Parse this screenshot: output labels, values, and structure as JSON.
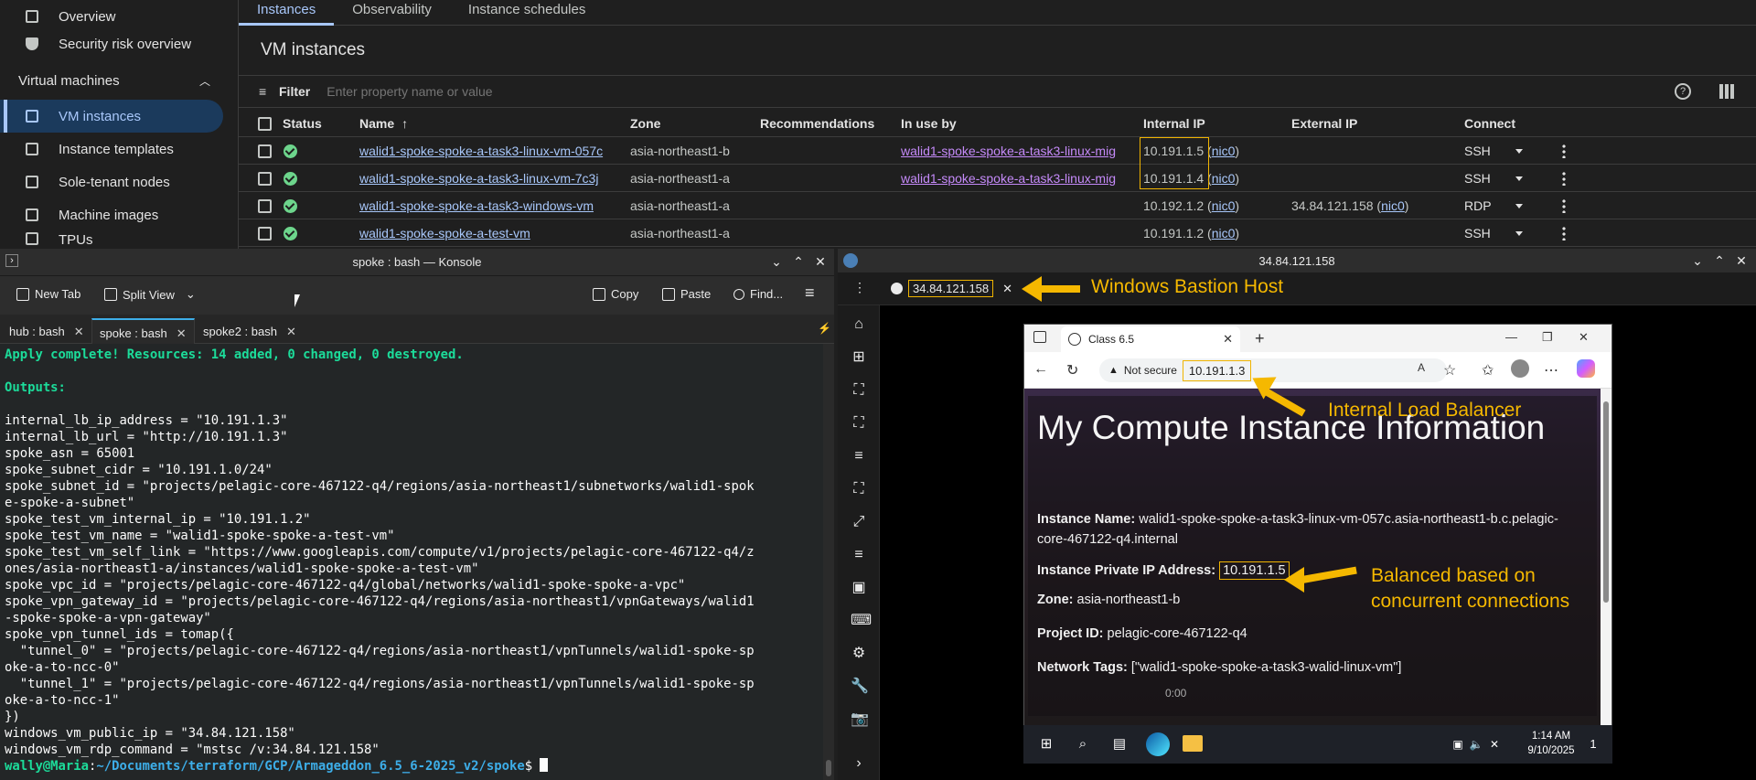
{
  "gcp": {
    "sidebar": {
      "items_top": [
        {
          "label": "Overview"
        },
        {
          "label": "Security risk overview"
        }
      ],
      "section": "Virtual machines",
      "items": [
        {
          "label": "VM instances"
        },
        {
          "label": "Instance templates"
        },
        {
          "label": "Sole-tenant nodes"
        },
        {
          "label": "Machine images"
        },
        {
          "label": "TPUs"
        }
      ]
    },
    "tabs": [
      "Instances",
      "Observability",
      "Instance schedules"
    ],
    "title": "VM instances",
    "filter": {
      "label": "Filter",
      "placeholder": "Enter property name or value"
    },
    "columns": {
      "status": "Status",
      "name": "Name",
      "zone": "Zone",
      "recommendations": "Recommendations",
      "in_use_by": "In use by",
      "internal_ip": "Internal IP",
      "external_ip": "External IP",
      "connect": "Connect"
    },
    "rows": [
      {
        "name": "walid1-spoke-spoke-a-task3-linux-vm-057c",
        "zone": "asia-northeast1-b",
        "in_use_by": "walid1-spoke-spoke-a-task3-linux-mig",
        "internal_ip": "10.191.1.5",
        "internal_nic": "nic0",
        "external_ip": "",
        "external_nic": "",
        "connect": "SSH"
      },
      {
        "name": "walid1-spoke-spoke-a-task3-linux-vm-7c3j",
        "zone": "asia-northeast1-a",
        "in_use_by": "walid1-spoke-spoke-a-task3-linux-mig",
        "internal_ip": "10.191.1.4",
        "internal_nic": "nic0",
        "external_ip": "",
        "external_nic": "",
        "connect": "SSH"
      },
      {
        "name": "walid1-spoke-spoke-a-task3-windows-vm",
        "zone": "asia-northeast1-a",
        "in_use_by": "",
        "internal_ip": "10.192.1.2",
        "internal_nic": "nic0",
        "external_ip": "34.84.121.158",
        "external_nic": "nic0",
        "connect": "RDP"
      },
      {
        "name": "walid1-spoke-spoke-a-test-vm",
        "zone": "asia-northeast1-a",
        "in_use_by": "",
        "internal_ip": "10.191.1.2",
        "internal_nic": "nic0",
        "external_ip": "",
        "external_nic": "",
        "connect": "SSH"
      }
    ]
  },
  "konsole": {
    "window_title": "spoke : bash — Konsole",
    "toolbar": {
      "new_tab": "New Tab",
      "split_view": "Split View",
      "copy": "Copy",
      "paste": "Paste",
      "find": "Find..."
    },
    "tabs": [
      "hub : bash",
      "spoke : bash",
      "spoke2 : bash"
    ],
    "active_tab": 1,
    "terminal_lines": [
      {
        "text": "Apply complete! Resources: 14 added, 0 changed, 0 destroyed.",
        "style": "green"
      },
      {
        "text": "",
        "style": ""
      },
      {
        "text": "Outputs:",
        "style": "green"
      },
      {
        "text": "",
        "style": ""
      },
      {
        "text": "internal_lb_ip_address = \"10.191.1.3\"",
        "style": ""
      },
      {
        "text": "internal_lb_url = \"http://10.191.1.3\"",
        "style": ""
      },
      {
        "text": "spoke_asn = 65001",
        "style": ""
      },
      {
        "text": "spoke_subnet_cidr = \"10.191.1.0/24\"",
        "style": ""
      },
      {
        "text": "spoke_subnet_id = \"projects/pelagic-core-467122-q4/regions/asia-northeast1/subnetworks/walid1-spok",
        "style": ""
      },
      {
        "text": "e-spoke-a-subnet\"",
        "style": ""
      },
      {
        "text": "spoke_test_vm_internal_ip = \"10.191.1.2\"",
        "style": ""
      },
      {
        "text": "spoke_test_vm_name = \"walid1-spoke-spoke-a-test-vm\"",
        "style": ""
      },
      {
        "text": "spoke_test_vm_self_link = \"https://www.googleapis.com/compute/v1/projects/pelagic-core-467122-q4/z",
        "style": ""
      },
      {
        "text": "ones/asia-northeast1-a/instances/walid1-spoke-spoke-a-test-vm\"",
        "style": ""
      },
      {
        "text": "spoke_vpc_id = \"projects/pelagic-core-467122-q4/global/networks/walid1-spoke-spoke-a-vpc\"",
        "style": ""
      },
      {
        "text": "spoke_vpn_gateway_id = \"projects/pelagic-core-467122-q4/regions/asia-northeast1/vpnGateways/walid1",
        "style": ""
      },
      {
        "text": "-spoke-spoke-a-vpn-gateway\"",
        "style": ""
      },
      {
        "text": "spoke_vpn_tunnel_ids = tomap({",
        "style": ""
      },
      {
        "text": "  \"tunnel_0\" = \"projects/pelagic-core-467122-q4/regions/asia-northeast1/vpnTunnels/walid1-spoke-sp",
        "style": ""
      },
      {
        "text": "oke-a-to-ncc-0\"",
        "style": ""
      },
      {
        "text": "  \"tunnel_1\" = \"projects/pelagic-core-467122-q4/regions/asia-northeast1/vpnTunnels/walid1-spoke-sp",
        "style": ""
      },
      {
        "text": "oke-a-to-ncc-1\"",
        "style": ""
      },
      {
        "text": "})",
        "style": ""
      },
      {
        "text": "windows_vm_public_ip = \"34.84.121.158\"",
        "style": ""
      },
      {
        "text": "windows_vm_rdp_command = \"mstsc /v:34.84.121.158\"",
        "style": ""
      }
    ],
    "prompt": {
      "user": "wally@Maria",
      "path": "~/Documents/terraform/GCP/Armageddon_6.5_6-2025_v2/spoke",
      "symbol": "$"
    }
  },
  "rdp": {
    "window_title": "34.84.121.158",
    "tab_label": "34.84.121.158",
    "annotation": "Windows Bastion Host",
    "browser": {
      "tab_title": "Class 6.5",
      "not_secure": "Not secure",
      "url": "10.191.1.3",
      "url_annotation": "Internal Load Balancer",
      "heading": "My Compute Instance Information",
      "instance_name_label": "Instance Name:",
      "instance_name": "walid1-spoke-spoke-a-task3-linux-vm-057c.asia-northeast1-b.c.pelagic-core-467122-q4.internal",
      "private_ip_label": "Instance Private IP Address:",
      "private_ip": "10.191.1.5",
      "ip_annotation_line1": "Balanced based on",
      "ip_annotation_line2": "concurrent connections",
      "zone_label": "Zone:",
      "zone": "asia-northeast1-b",
      "project_label": "Project ID:",
      "project": "pelagic-core-467122-q4",
      "tags_label": "Network Tags:",
      "tags": "[\"walid1-spoke-spoke-a-task3-walid-linux-vm\"]",
      "video_time": "0:00"
    },
    "taskbar": {
      "time": "1:14 AM",
      "date": "9/10/2025",
      "notifications": "1"
    }
  },
  "colors": {
    "accent": "#a8c7fa",
    "annotation": "#f5b800",
    "link_purple": "#c58af9",
    "status_ok": "#6dd58c",
    "terminal_green": "#1cdc9a"
  }
}
